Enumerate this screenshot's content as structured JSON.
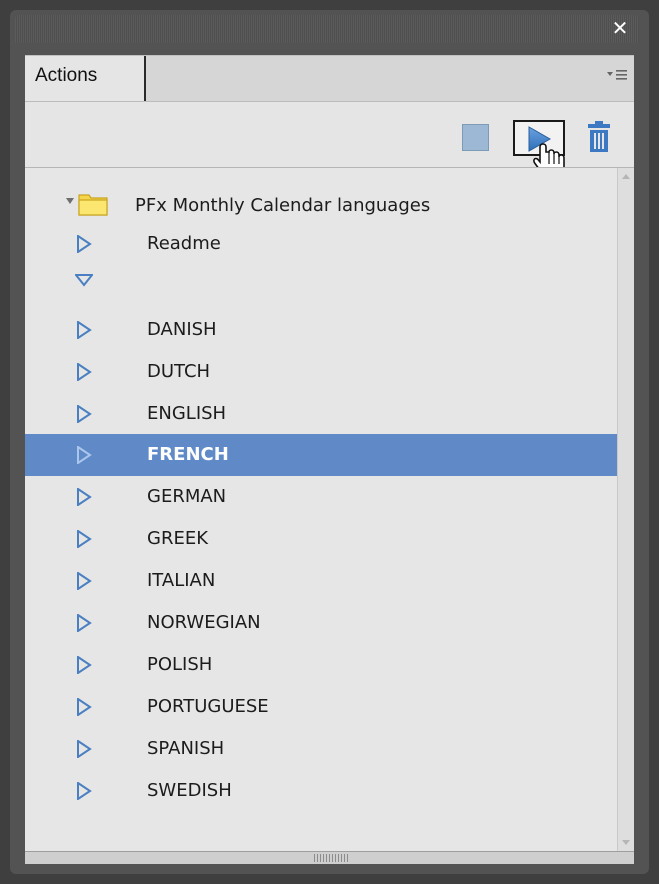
{
  "window": {
    "close_symbol": "✕"
  },
  "tabs": [
    {
      "label": "Actions",
      "active": true
    }
  ],
  "panel_menu_icon": "panel-menu-icon",
  "toolbar": {
    "stop_icon": "stop-square-icon",
    "play_icon": "play-icon",
    "delete_icon": "trash-icon",
    "cursor_icon": "hand-pointer-icon"
  },
  "tree": {
    "folder": {
      "label": "PFx Monthly Calendar languages",
      "expanded": true,
      "icon": "folder-icon"
    },
    "items": [
      {
        "label": "Readme",
        "expanded": false,
        "selected": false
      },
      {
        "label": "",
        "expanded": true,
        "selected": false
      },
      {
        "label": "DANISH",
        "expanded": false,
        "selected": false
      },
      {
        "label": "DUTCH",
        "expanded": false,
        "selected": false
      },
      {
        "label": "ENGLISH",
        "expanded": false,
        "selected": false
      },
      {
        "label": "FRENCH",
        "expanded": false,
        "selected": true
      },
      {
        "label": "GERMAN",
        "expanded": false,
        "selected": false
      },
      {
        "label": "GREEK",
        "expanded": false,
        "selected": false
      },
      {
        "label": "ITALIAN",
        "expanded": false,
        "selected": false
      },
      {
        "label": "NORWEGIAN",
        "expanded": false,
        "selected": false
      },
      {
        "label": "POLISH",
        "expanded": false,
        "selected": false
      },
      {
        "label": "PORTUGUESE",
        "expanded": false,
        "selected": false
      },
      {
        "label": "SPANISH",
        "expanded": false,
        "selected": false
      },
      {
        "label": "SWEDISH",
        "expanded": false,
        "selected": false
      }
    ]
  },
  "colors": {
    "selection": "#5f8ac7",
    "triangle": "#4a7fc1",
    "folder": "#f5d64b"
  }
}
